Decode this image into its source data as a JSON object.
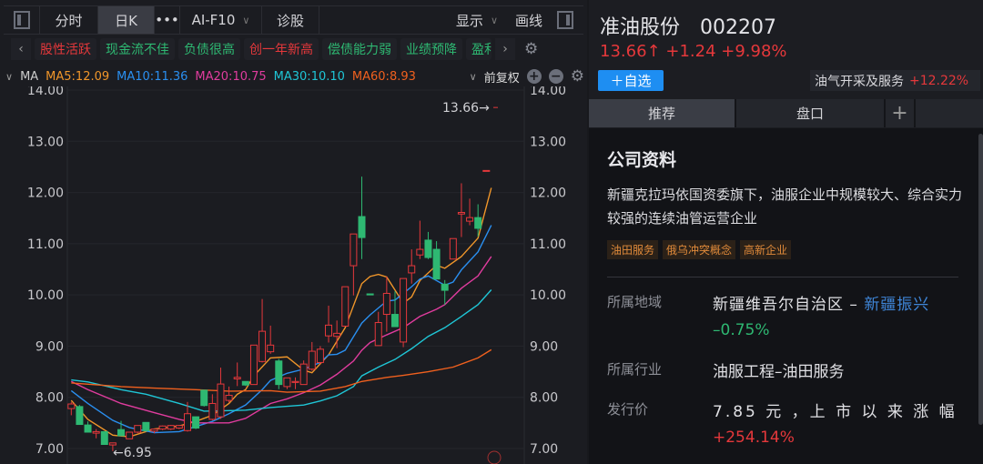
{
  "toolbar": {
    "items": [
      "分时",
      "日K",
      "•••",
      "AI-F10",
      "诊股",
      "显示",
      "画线"
    ],
    "active": "日K"
  },
  "tags": [
    {
      "label": "股性活跃",
      "color": "#e5383b"
    },
    {
      "label": "现金流不佳",
      "color": "#2eb872"
    },
    {
      "label": "负债很高",
      "color": "#2eb872"
    },
    {
      "label": "创一年新高",
      "color": "#e5383b"
    },
    {
      "label": "偿债能力弱",
      "color": "#2eb872"
    },
    {
      "label": "业绩预降",
      "color": "#2eb872"
    },
    {
      "label": "盈利",
      "color": "#2eb872"
    }
  ],
  "ma_bar": {
    "label": "MA",
    "items": [
      {
        "label": "MA5:12.09",
        "color": "#f0962a"
      },
      {
        "label": "MA10:11.36",
        "color": "#2a8ff0"
      },
      {
        "label": "MA20:10.75",
        "color": "#e03c9e"
      },
      {
        "label": "MA30:10.10",
        "color": "#1fc6d6"
      },
      {
        "label": "MA60:8.93",
        "color": "#f0601e"
      }
    ],
    "adjust": "前复权"
  },
  "chart_data": {
    "type": "candlestick",
    "ylim": [
      7.0,
      14.0
    ],
    "yticks": [
      "14.00",
      "13.00",
      "12.00",
      "11.00",
      "10.00",
      "9.00",
      "8.00",
      "7.00"
    ],
    "up_color": "#e5383b",
    "down_color": "#2eb872",
    "last_label": "13.66→",
    "low_label": "←6.95",
    "candles": [
      [
        7.78,
        7.87,
        7.91,
        7.65
      ],
      [
        7.82,
        7.47,
        7.85,
        7.47
      ],
      [
        7.46,
        7.32,
        7.53,
        7.32
      ],
      [
        7.3,
        7.33,
        7.38,
        7.2
      ],
      [
        7.33,
        7.08,
        7.33,
        7.08
      ],
      [
        7.07,
        7.11,
        7.11,
        6.95
      ],
      [
        7.37,
        7.25,
        7.54,
        7.25
      ],
      [
        7.19,
        7.32,
        7.32,
        7.19
      ],
      [
        7.32,
        7.45,
        7.45,
        7.3
      ],
      [
        7.51,
        7.35,
        7.51,
        7.33
      ],
      [
        7.34,
        7.38,
        7.38,
        7.3
      ],
      [
        7.38,
        7.44,
        7.45,
        7.36
      ],
      [
        7.38,
        7.45,
        7.46,
        7.36
      ],
      [
        7.4,
        7.45,
        7.46,
        7.38
      ],
      [
        7.35,
        7.68,
        7.91,
        7.33
      ],
      [
        7.62,
        7.4,
        7.62,
        7.38
      ],
      [
        8.14,
        7.84,
        8.14,
        7.82
      ],
      [
        7.57,
        7.88,
        8.06,
        7.55
      ],
      [
        7.62,
        8.26,
        8.58,
        7.58
      ],
      [
        7.94,
        8.04,
        8.21,
        7.9
      ],
      [
        8.36,
        8.39,
        8.68,
        8.22
      ],
      [
        8.31,
        8.24,
        8.31,
        8.22
      ],
      [
        8.25,
        9.02,
        9.02,
        8.25
      ],
      [
        8.7,
        9.29,
        9.92,
        8.68
      ],
      [
        8.89,
        9.02,
        9.4,
        8.85
      ],
      [
        8.71,
        8.25,
        8.75,
        8.16
      ],
      [
        8.21,
        8.38,
        8.38,
        8.16
      ],
      [
        8.29,
        8.31,
        8.39,
        8.16
      ],
      [
        8.25,
        8.65,
        8.72,
        8.25
      ],
      [
        8.55,
        8.9,
        9.08,
        8.52
      ],
      [
        8.68,
        8.94,
        9.0,
        8.65
      ],
      [
        9.2,
        9.41,
        9.79,
        9.07
      ],
      [
        9.19,
        9.25,
        9.5,
        8.96
      ],
      [
        9.39,
        10.16,
        10.16,
        9.39
      ],
      [
        10.57,
        11.19,
        11.19,
        9.99
      ],
      [
        11.53,
        11.12,
        12.31,
        10.7
      ],
      [
        10.02,
        10.0,
        10.02,
        10.0
      ],
      [
        9.01,
        9.46,
        9.67,
        9.01
      ],
      [
        9.62,
        10.03,
        10.36,
        9.28
      ],
      [
        9.62,
        9.38,
        10.07,
        9.38
      ],
      [
        9.08,
        10.32,
        10.32,
        8.98
      ],
      [
        10.43,
        10.57,
        10.89,
        10.22
      ],
      [
        10.78,
        10.89,
        11.45,
        10.7
      ],
      [
        11.07,
        10.73,
        11.23,
        10.7
      ],
      [
        10.89,
        10.31,
        11.05,
        10.31
      ],
      [
        10.21,
        10.09,
        10.29,
        9.81
      ],
      [
        10.7,
        11.1,
        11.1,
        10.7
      ],
      [
        11.58,
        11.61,
        12.18,
        11.13
      ],
      [
        11.44,
        11.51,
        11.88,
        11.36
      ],
      [
        11.51,
        11.3,
        11.77,
        11.14
      ],
      [
        12.43,
        12.43,
        12.43,
        12.43
      ]
    ],
    "series": [
      {
        "name": "MA5",
        "color": "#f0962a",
        "points": [
          [
            0,
            7.94
          ],
          [
            2,
            7.57
          ],
          [
            5,
            7.26
          ],
          [
            7,
            7.23
          ],
          [
            10,
            7.38
          ],
          [
            13,
            7.44
          ],
          [
            15,
            7.53
          ],
          [
            17,
            7.65
          ],
          [
            19,
            7.88
          ],
          [
            20,
            8.06
          ],
          [
            21,
            8.15
          ],
          [
            22,
            8.42
          ],
          [
            24,
            8.77
          ],
          [
            26,
            8.79
          ],
          [
            28,
            8.53
          ],
          [
            29,
            8.48
          ],
          [
            31,
            8.83
          ],
          [
            33,
            9.36
          ],
          [
            35,
            10.22
          ],
          [
            36,
            10.36
          ],
          [
            37,
            10.4
          ],
          [
            38,
            10.35
          ],
          [
            40,
            9.84
          ],
          [
            41,
            9.96
          ],
          [
            42,
            10.28
          ],
          [
            44,
            10.58
          ],
          [
            45,
            10.52
          ],
          [
            47,
            10.75
          ],
          [
            49,
            11.11
          ],
          [
            50.6,
            12.09
          ]
        ]
      },
      {
        "name": "MA10",
        "color": "#2a8ff0",
        "points": [
          [
            0,
            8.13
          ],
          [
            2,
            7.88
          ],
          [
            5,
            7.55
          ],
          [
            7,
            7.41
          ],
          [
            10,
            7.31
          ],
          [
            13,
            7.33
          ],
          [
            15,
            7.43
          ],
          [
            17,
            7.53
          ],
          [
            19,
            7.68
          ],
          [
            21,
            7.85
          ],
          [
            23,
            8.15
          ],
          [
            24,
            8.33
          ],
          [
            26,
            8.47
          ],
          [
            28,
            8.55
          ],
          [
            30,
            8.68
          ],
          [
            31,
            8.83
          ],
          [
            32,
            8.84
          ],
          [
            33,
            8.92
          ],
          [
            35,
            9.45
          ],
          [
            36,
            9.61
          ],
          [
            38,
            9.88
          ],
          [
            39,
            9.9
          ],
          [
            41,
            10.16
          ],
          [
            42,
            10.31
          ],
          [
            43,
            10.37
          ],
          [
            45,
            10.19
          ],
          [
            46,
            10.25
          ],
          [
            47,
            10.49
          ],
          [
            49,
            10.84
          ],
          [
            50.6,
            11.36
          ]
        ]
      },
      {
        "name": "MA20",
        "color": "#e03c9e",
        "points": [
          [
            0,
            8.31
          ],
          [
            2,
            8.15
          ],
          [
            6,
            7.88
          ],
          [
            10,
            7.7
          ],
          [
            13,
            7.57
          ],
          [
            15,
            7.5
          ],
          [
            19,
            7.5
          ],
          [
            21,
            7.59
          ],
          [
            24,
            7.88
          ],
          [
            26,
            7.97
          ],
          [
            28,
            8.09
          ],
          [
            30,
            8.24
          ],
          [
            32,
            8.45
          ],
          [
            34,
            8.71
          ],
          [
            35,
            8.92
          ],
          [
            36,
            9.07
          ],
          [
            38,
            9.22
          ],
          [
            40,
            9.36
          ],
          [
            42,
            9.58
          ],
          [
            44,
            9.72
          ],
          [
            45,
            9.81
          ],
          [
            47,
            10.13
          ],
          [
            49,
            10.37
          ],
          [
            50.6,
            10.75
          ]
        ]
      },
      {
        "name": "MA30",
        "color": "#1fc6d6",
        "points": [
          [
            0,
            8.34
          ],
          [
            2,
            8.3
          ],
          [
            6,
            8.15
          ],
          [
            9,
            8.06
          ],
          [
            13,
            7.88
          ],
          [
            16,
            7.73
          ],
          [
            19,
            7.74
          ],
          [
            21,
            7.75
          ],
          [
            24,
            7.8
          ],
          [
            28,
            7.85
          ],
          [
            30,
            7.93
          ],
          [
            32,
            8.03
          ],
          [
            34,
            8.21
          ],
          [
            35,
            8.42
          ],
          [
            37,
            8.59
          ],
          [
            39,
            8.74
          ],
          [
            41,
            8.95
          ],
          [
            43,
            9.19
          ],
          [
            45,
            9.36
          ],
          [
            47,
            9.58
          ],
          [
            49,
            9.81
          ],
          [
            50.6,
            10.1
          ]
        ]
      },
      {
        "name": "MA60",
        "color": "#f0601e",
        "points": [
          [
            0,
            8.28
          ],
          [
            6,
            8.21
          ],
          [
            10,
            8.18
          ],
          [
            15,
            8.15
          ],
          [
            19,
            8.12
          ],
          [
            24,
            8.13
          ],
          [
            26,
            8.1
          ],
          [
            30,
            8.12
          ],
          [
            33,
            8.21
          ],
          [
            35,
            8.31
          ],
          [
            38,
            8.39
          ],
          [
            40,
            8.43
          ],
          [
            43,
            8.5
          ],
          [
            46,
            8.59
          ],
          [
            49,
            8.77
          ],
          [
            50.6,
            8.93
          ]
        ]
      }
    ]
  },
  "stock": {
    "name": "准油股份",
    "code": "002207",
    "price": "13.66↑",
    "change": "+1.24",
    "pct": "+9.98%",
    "add_watch": "＋自选",
    "sector": "油气开采及服务",
    "sector_pct": "+12.22%"
  },
  "tabs": [
    "推荐",
    "盘口",
    "+"
  ],
  "company": {
    "title": "公司资料",
    "desc": "新疆克拉玛依国资委旗下，油服企业中规模较大、综合实力较强的连续油管运营企业",
    "tags": [
      "油田服务",
      "俄乌冲突概念",
      "高新企业"
    ],
    "region_label": "所属地域",
    "region": "新疆维吾尔自治区 – ",
    "region_link": "新疆振兴",
    "region_pct": "–0.75%",
    "industry_label": "所属行业",
    "industry": "油服工程–油田服务",
    "ipo_label": "发行价",
    "ipo": "7.85 元 ，上 市 以 来 涨 幅",
    "ipo_pct": "+254.14%"
  }
}
